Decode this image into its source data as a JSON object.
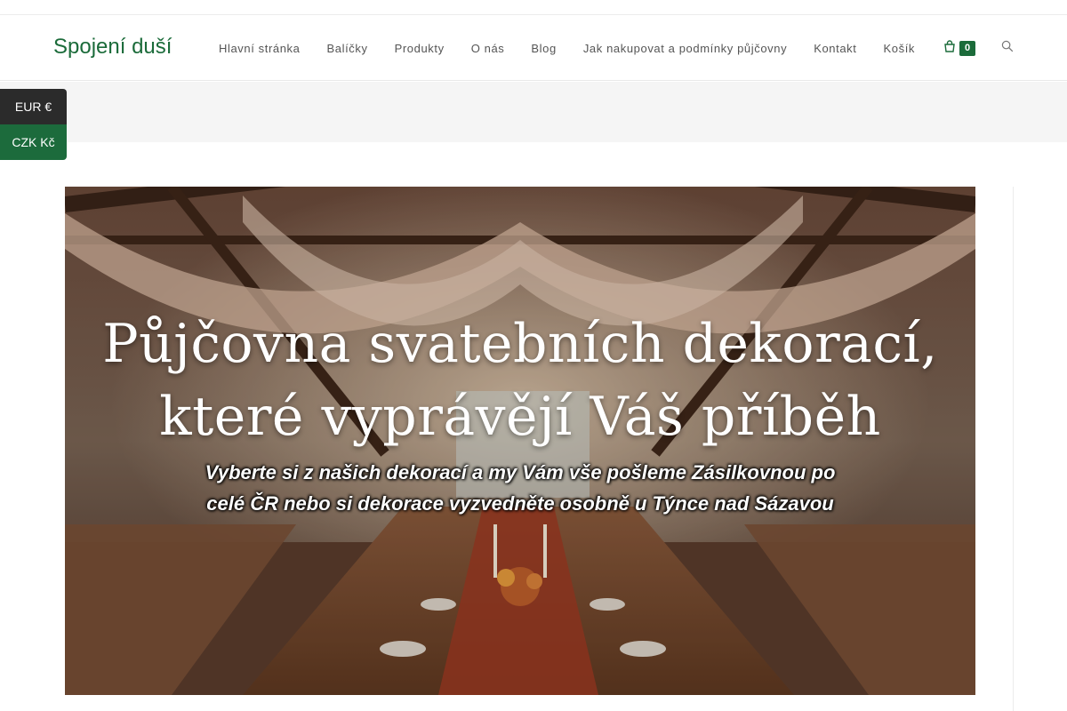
{
  "site": {
    "logo": "Spojení duší"
  },
  "nav": {
    "items": [
      {
        "label": "Hlavní stránka"
      },
      {
        "label": "Balíčky"
      },
      {
        "label": "Produkty"
      },
      {
        "label": "O nás"
      },
      {
        "label": "Blog"
      },
      {
        "label": "Jak nakupovat a podmínky půjčovny"
      },
      {
        "label": "Kontakt"
      },
      {
        "label": "Košík"
      }
    ],
    "cart_count": "0",
    "cart_icon": "shopping-bag-icon",
    "search_icon": "search-icon"
  },
  "currency": {
    "options": [
      {
        "label": "EUR €"
      },
      {
        "label": "CZK Kč"
      }
    ],
    "selected": "CZK Kč"
  },
  "hero": {
    "title_line1": "Půjčovna svatebních dekorací,",
    "title_line2": "které vyprávějí Váš příběh",
    "subtitle_line1": "Vyberte si z našich dekorací a my Vám vše pošleme Zásilkovnou po",
    "subtitle_line2": "celé ČR nebo si dekorace vyzvedněte osobně u Týnce nad Sázavou"
  },
  "colors": {
    "brand_green": "#1b6b3a",
    "currency_dark": "#2b2b2b",
    "currency_green": "#1c6b3c",
    "nav_text": "#555555"
  }
}
